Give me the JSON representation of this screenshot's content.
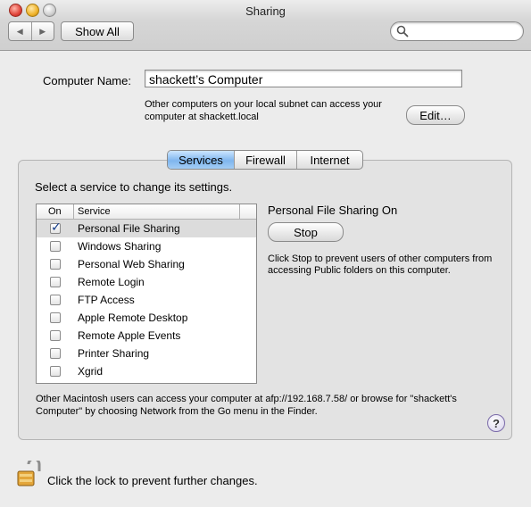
{
  "window": {
    "title": "Sharing"
  },
  "toolbar": {
    "back_glyph": "◀",
    "forward_glyph": "▶",
    "show_all_label": "Show All",
    "search_placeholder": ""
  },
  "computer": {
    "name_label": "Computer Name:",
    "name_value": "shackett’s Computer",
    "description": "Other computers on your local subnet can access your computer at shackett.local",
    "edit_label": "Edit…"
  },
  "tabs": [
    {
      "label": "Services",
      "active": true
    },
    {
      "label": "Firewall",
      "active": false
    },
    {
      "label": "Internet",
      "active": false
    }
  ],
  "services": {
    "hint": "Select a service to change its settings.",
    "columns": {
      "on": "On",
      "service": "Service"
    },
    "items": [
      {
        "label": "Personal File Sharing",
        "on": true,
        "selected": true
      },
      {
        "label": "Windows Sharing",
        "on": false
      },
      {
        "label": "Personal Web Sharing",
        "on": false
      },
      {
        "label": "Remote Login",
        "on": false
      },
      {
        "label": "FTP Access",
        "on": false
      },
      {
        "label": "Apple Remote Desktop",
        "on": false
      },
      {
        "label": "Remote Apple Events",
        "on": false
      },
      {
        "label": "Printer Sharing",
        "on": false
      },
      {
        "label": "Xgrid",
        "on": false
      }
    ]
  },
  "status": {
    "title": "Personal File Sharing On",
    "stop_label": "Stop",
    "description": "Click Stop to prevent users of other computers from accessing Public folders on this computer."
  },
  "access_note": "Other Macintosh users can access your computer at afp://192.168.7.58/ or browse for \"shackett's Computer\" by choosing Network from the Go menu in the Finder.",
  "help_label": "?",
  "lock_text": "Click the lock to prevent further changes.",
  "colors": {
    "selected_tab": "#7fb6ee",
    "window_bg": "#ececec",
    "checkmark": "#123b8a"
  }
}
